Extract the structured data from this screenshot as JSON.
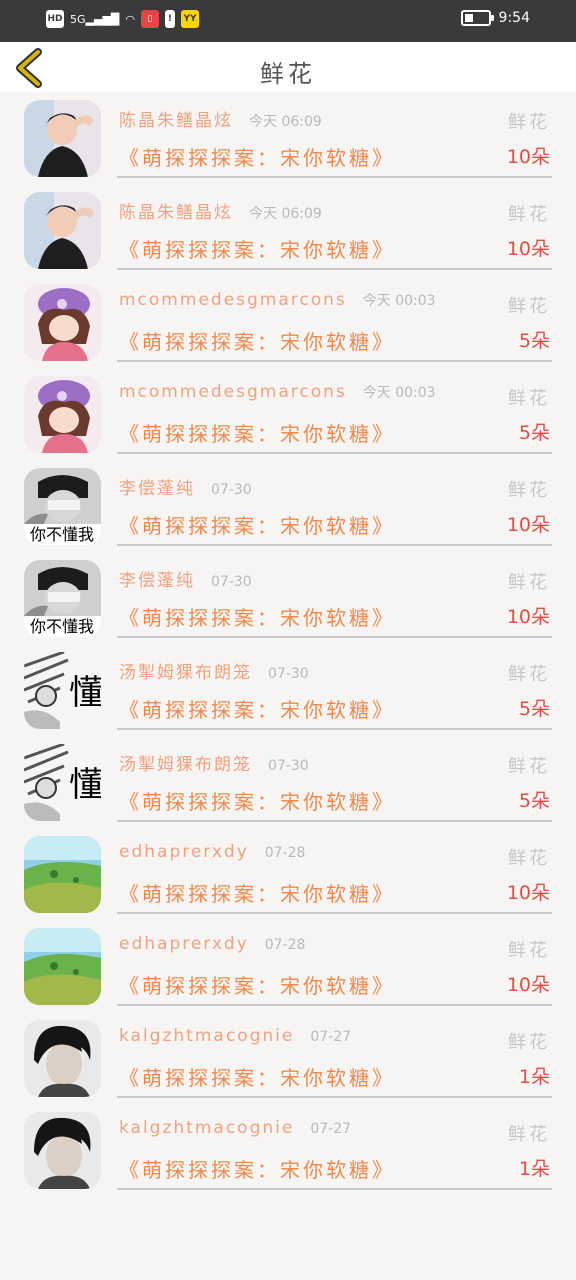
{
  "status_bar": {
    "hd": "HD",
    "network": "5G",
    "time": "9:54",
    "yy": "YY"
  },
  "header": {
    "title": "鲜花"
  },
  "colors": {
    "name": "#f0a27f",
    "book_title": "#f08a4b",
    "count": "#e44c48",
    "muted": "#b9b9b9",
    "back_arrow": "#d6b400"
  },
  "rows": [
    {
      "name": "陈晶朱鳝晶炫",
      "time": "今天 06:09",
      "gift": "鲜花",
      "book": "《萌探探探案：宋你软糖》",
      "count": "10朵",
      "avatar": "avatar-boy-hand"
    },
    {
      "name": "陈晶朱鳝晶炫",
      "time": "今天 06:09",
      "gift": "鲜花",
      "book": "《萌探探探案：宋你软糖》",
      "count": "10朵",
      "avatar": "avatar-boy-hand"
    },
    {
      "name": "mcommedesgmarcons",
      "time": "今天 00:03",
      "gift": "鲜花",
      "book": "《萌探探探案：宋你软糖》",
      "count": "5朵",
      "avatar": "avatar-girl-purple-hat"
    },
    {
      "name": "mcommedesgmarcons",
      "time": "今天 00:03",
      "gift": "鲜花",
      "book": "《萌探探探案：宋你软糖》",
      "count": "5朵",
      "avatar": "avatar-girl-purple-hat"
    },
    {
      "name": "李偿蓬纯",
      "time": "07-30",
      "gift": "鲜花",
      "book": "《萌探探探案：宋你软糖》",
      "count": "10朵",
      "avatar": "avatar-bw-boy",
      "caption": "你不懂我"
    },
    {
      "name": "李偿蓬纯",
      "time": "07-30",
      "gift": "鲜花",
      "book": "《萌探探探案：宋你软糖》",
      "count": "10朵",
      "avatar": "avatar-bw-boy",
      "caption": "你不懂我"
    },
    {
      "name": "汤掣姆猓布朗笼",
      "time": "07-30",
      "gift": "鲜花",
      "book": "《萌探探探案：宋你软糖》",
      "count": "5朵",
      "avatar": "avatar-sketch",
      "caption": "懂"
    },
    {
      "name": "汤掣姆猓布朗笼",
      "time": "07-30",
      "gift": "鲜花",
      "book": "《萌探探探案：宋你软糖》",
      "count": "5朵",
      "avatar": "avatar-sketch",
      "caption": "懂"
    },
    {
      "name": "edhaprerxdy",
      "time": "07-28",
      "gift": "鲜花",
      "book": "《萌探探探案：宋你软糖》",
      "count": "10朵",
      "avatar": "avatar-landscape"
    },
    {
      "name": "edhaprerxdy",
      "time": "07-28",
      "gift": "鲜花",
      "book": "《萌探探探案：宋你软糖》",
      "count": "10朵",
      "avatar": "avatar-landscape"
    },
    {
      "name": "kalgzhtmacognie",
      "time": "07-27",
      "gift": "鲜花",
      "book": "《萌探探探案：宋你软糖》",
      "count": "1朵",
      "avatar": "avatar-dark-hair"
    },
    {
      "name": "kalgzhtmacognie",
      "time": "07-27",
      "gift": "鲜花",
      "book": "《萌探探探案：宋你软糖》",
      "count": "1朵",
      "avatar": "avatar-dark-hair"
    }
  ]
}
